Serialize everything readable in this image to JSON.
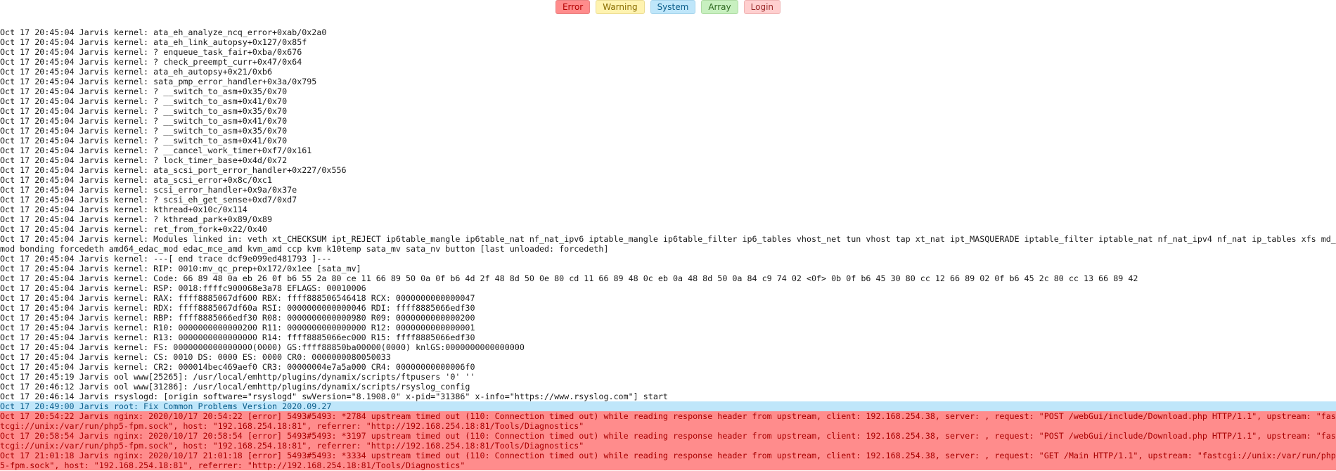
{
  "filters": [
    {
      "label": "Error",
      "kind": "error"
    },
    {
      "label": "Warning",
      "kind": "warning"
    },
    {
      "label": "System",
      "kind": "system"
    },
    {
      "label": "Array",
      "kind": "array"
    },
    {
      "label": "Login",
      "kind": "login"
    }
  ],
  "log_lines": [
    {
      "level": "normal",
      "text": "Oct 17 20:45:04 Jarvis kernel: ata_eh_analyze_ncq_error+0xab/0x2a0"
    },
    {
      "level": "normal",
      "text": "Oct 17 20:45:04 Jarvis kernel: ata_eh_link_autopsy+0x127/0x85f"
    },
    {
      "level": "normal",
      "text": "Oct 17 20:45:04 Jarvis kernel: ? enqueue_task_fair+0xba/0x676"
    },
    {
      "level": "normal",
      "text": "Oct 17 20:45:04 Jarvis kernel: ? check_preempt_curr+0x47/0x64"
    },
    {
      "level": "normal",
      "text": "Oct 17 20:45:04 Jarvis kernel: ata_eh_autopsy+0x21/0xb6"
    },
    {
      "level": "normal",
      "text": "Oct 17 20:45:04 Jarvis kernel: sata_pmp_error_handler+0x3a/0x795"
    },
    {
      "level": "normal",
      "text": "Oct 17 20:45:04 Jarvis kernel: ? __switch_to_asm+0x35/0x70"
    },
    {
      "level": "normal",
      "text": "Oct 17 20:45:04 Jarvis kernel: ? __switch_to_asm+0x41/0x70"
    },
    {
      "level": "normal",
      "text": "Oct 17 20:45:04 Jarvis kernel: ? __switch_to_asm+0x35/0x70"
    },
    {
      "level": "normal",
      "text": "Oct 17 20:45:04 Jarvis kernel: ? __switch_to_asm+0x41/0x70"
    },
    {
      "level": "normal",
      "text": "Oct 17 20:45:04 Jarvis kernel: ? __switch_to_asm+0x35/0x70"
    },
    {
      "level": "normal",
      "text": "Oct 17 20:45:04 Jarvis kernel: ? __switch_to_asm+0x41/0x70"
    },
    {
      "level": "normal",
      "text": "Oct 17 20:45:04 Jarvis kernel: ? __cancel_work_timer+0xf7/0x161"
    },
    {
      "level": "normal",
      "text": "Oct 17 20:45:04 Jarvis kernel: ? lock_timer_base+0x4d/0x72"
    },
    {
      "level": "normal",
      "text": "Oct 17 20:45:04 Jarvis kernel: ata_scsi_port_error_handler+0x227/0x556"
    },
    {
      "level": "normal",
      "text": "Oct 17 20:45:04 Jarvis kernel: ata_scsi_error+0x8c/0xc1"
    },
    {
      "level": "normal",
      "text": "Oct 17 20:45:04 Jarvis kernel: scsi_error_handler+0x9a/0x37e"
    },
    {
      "level": "normal",
      "text": "Oct 17 20:45:04 Jarvis kernel: ? scsi_eh_get_sense+0xd7/0xd7"
    },
    {
      "level": "normal",
      "text": "Oct 17 20:45:04 Jarvis kernel: kthread+0x10c/0x114"
    },
    {
      "level": "normal",
      "text": "Oct 17 20:45:04 Jarvis kernel: ? kthread_park+0x89/0x89"
    },
    {
      "level": "normal",
      "text": "Oct 17 20:45:04 Jarvis kernel: ret_from_fork+0x22/0x40"
    },
    {
      "level": "normal",
      "text": "Oct 17 20:45:04 Jarvis kernel: Modules linked in: veth xt_CHECKSUM ipt_REJECT ip6table_mangle ip6table_nat nf_nat_ipv6 iptable_mangle ip6table_filter ip6_tables vhost_net tun vhost tap xt_nat ipt_MASQUERADE iptable_filter iptable_nat nf_nat_ipv4 nf_nat ip_tables xfs md_mod bonding forcedeth amd64_edac_mod edac_mce_amd kvm_amd ccp kvm k10temp sata_mv sata_nv button [last unloaded: forcedeth]"
    },
    {
      "level": "normal",
      "text": "Oct 17 20:45:04 Jarvis kernel: ---[ end trace dcf9e099ed481793 ]---"
    },
    {
      "level": "normal",
      "text": "Oct 17 20:45:04 Jarvis kernel: RIP: 0010:mv_qc_prep+0x172/0x1ee [sata_mv]"
    },
    {
      "level": "normal",
      "text": "Oct 17 20:45:04 Jarvis kernel: Code: 66 89 48 0a eb 26 0f b6 55 2a 80 ce 11 66 89 50 0a 0f b6 4d 2f 48 8d 50 0e 80 cd 11 66 89 48 0c eb 0a 48 8d 50 0a 84 c9 74 02 <0f> 0b 0f b6 45 30 80 cc 12 66 89 02 0f b6 45 2c 80 cc 13 66 89 42"
    },
    {
      "level": "normal",
      "text": "Oct 17 20:45:04 Jarvis kernel: RSP: 0018:ffffc900068e3a78 EFLAGS: 00010006"
    },
    {
      "level": "normal",
      "text": "Oct 17 20:45:04 Jarvis kernel: RAX: ffff8885067df600 RBX: ffff888506546418 RCX: 0000000000000047"
    },
    {
      "level": "normal",
      "text": "Oct 17 20:45:04 Jarvis kernel: RDX: ffff8885067df60a RSI: 0000000000000046 RDI: ffff8885066edf30"
    },
    {
      "level": "normal",
      "text": "Oct 17 20:45:04 Jarvis kernel: RBP: ffff8885066edf30 R08: 0000000000000980 R09: 0000000000000200"
    },
    {
      "level": "normal",
      "text": "Oct 17 20:45:04 Jarvis kernel: R10: 0000000000000200 R11: 0000000000000000 R12: 0000000000000001"
    },
    {
      "level": "normal",
      "text": "Oct 17 20:45:04 Jarvis kernel: R13: 0000000000000000 R14: ffff8885066ec000 R15: ffff8885066edf30"
    },
    {
      "level": "normal",
      "text": "Oct 17 20:45:04 Jarvis kernel: FS: 0000000000000000(0000) GS:ffff88850ba00000(0000) knlGS:0000000000000000"
    },
    {
      "level": "normal",
      "text": "Oct 17 20:45:04 Jarvis kernel: CS: 0010 DS: 0000 ES: 0000 CR0: 0000000080050033"
    },
    {
      "level": "normal",
      "text": "Oct 17 20:45:04 Jarvis kernel: CR2: 000014bec469aef0 CR3: 00000004e7a5a000 CR4: 00000000000006f0"
    },
    {
      "level": "normal",
      "text": "Oct 17 20:45:19 Jarvis ool www[25265]: /usr/local/emhttp/plugins/dynamix/scripts/ftpusers '0' ''"
    },
    {
      "level": "normal",
      "text": "Oct 17 20:46:12 Jarvis ool www[31286]: /usr/local/emhttp/plugins/dynamix/scripts/rsyslog_config"
    },
    {
      "level": "normal",
      "text": "Oct 17 20:46:14 Jarvis rsyslogd: [origin software=\"rsyslogd\" swVersion=\"8.1908.0\" x-pid=\"31386\" x-info=\"https://www.rsyslog.com\"] start"
    },
    {
      "level": "system",
      "text": "Oct 17 20:49:00 Jarvis root: Fix Common Problems Version 2020.09.27"
    },
    {
      "level": "error",
      "text": "Oct 17 20:54:22 Jarvis nginx: 2020/10/17 20:54:22 [error] 5493#5493: *2784 upstream timed out (110: Connection timed out) while reading response header from upstream, client: 192.168.254.38, server: , request: \"POST /webGui/include/Download.php HTTP/1.1\", upstream: \"fastcgi://unix:/var/run/php5-fpm.sock\", host: \"192.168.254.18:81\", referrer: \"http://192.168.254.18:81/Tools/Diagnostics\""
    },
    {
      "level": "error",
      "text": "Oct 17 20:58:54 Jarvis nginx: 2020/10/17 20:58:54 [error] 5493#5493: *3197 upstream timed out (110: Connection timed out) while reading response header from upstream, client: 192.168.254.38, server: , request: \"POST /webGui/include/Download.php HTTP/1.1\", upstream: \"fastcgi://unix:/var/run/php5-fpm.sock\", host: \"192.168.254.18:81\", referrer: \"http://192.168.254.18:81/Tools/Diagnostics\""
    },
    {
      "level": "error",
      "text": "Oct 17 21:01:18 Jarvis nginx: 2020/10/17 21:01:18 [error] 5493#5493: *3334 upstream timed out (110: Connection timed out) while reading response header from upstream, client: 192.168.254.38, server: , request: \"GET /Main HTTP/1.1\", upstream: \"fastcgi://unix:/var/run/php5-fpm.sock\", host: \"192.168.254.18:81\", referrer: \"http://192.168.254.18:81/Tools/Diagnostics\""
    }
  ]
}
